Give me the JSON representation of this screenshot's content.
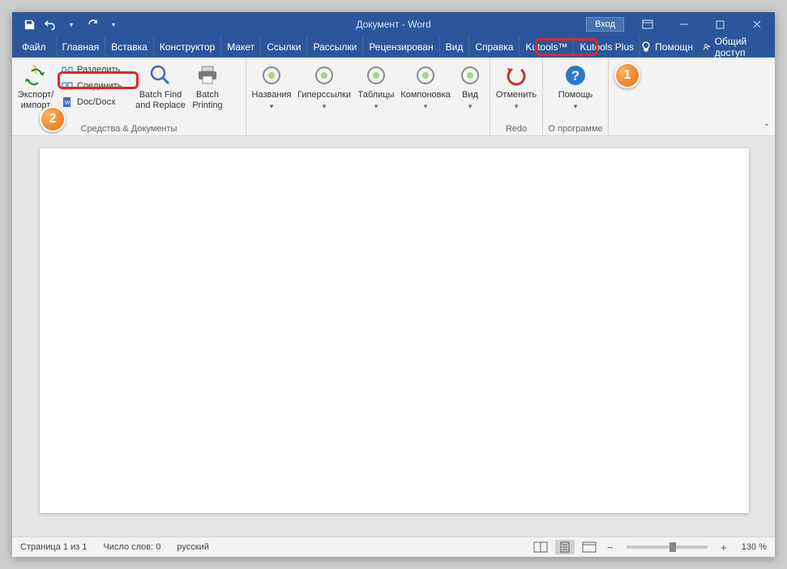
{
  "title": "Документ - Word",
  "login": "Вход",
  "tabs": [
    "Файл",
    "Главная",
    "Вставка",
    "Конструктор",
    "Макет",
    "Ссылки",
    "Рассылки",
    "Рецензирован",
    "Вид",
    "Справка",
    "Kutools™",
    "Kutools Plus"
  ],
  "tabs_right": {
    "help": "Помощн",
    "share": "Общий доступ"
  },
  "ribbon": {
    "export": "Экспорт/\nимпорт",
    "small": {
      "split": "Разделить",
      "merge": "Соединить",
      "docdocx": "Doc/Docx"
    },
    "batchfind": "Batch Find\nand Replace",
    "batchprint": "Batch\nPrinting",
    "group1": "Средства & Документы",
    "names": "Названия",
    "hyper": "Гиперссылки",
    "tables": "Таблицы",
    "layout": "Компоновка",
    "view": "Вид",
    "cancel": "Отменить",
    "redo": "Redo",
    "help": "Помощь",
    "about": "О программе"
  },
  "status": {
    "page": "Страница 1 из 1",
    "words": "Число слов: 0",
    "lang": "русский",
    "zoom": "130 %"
  }
}
